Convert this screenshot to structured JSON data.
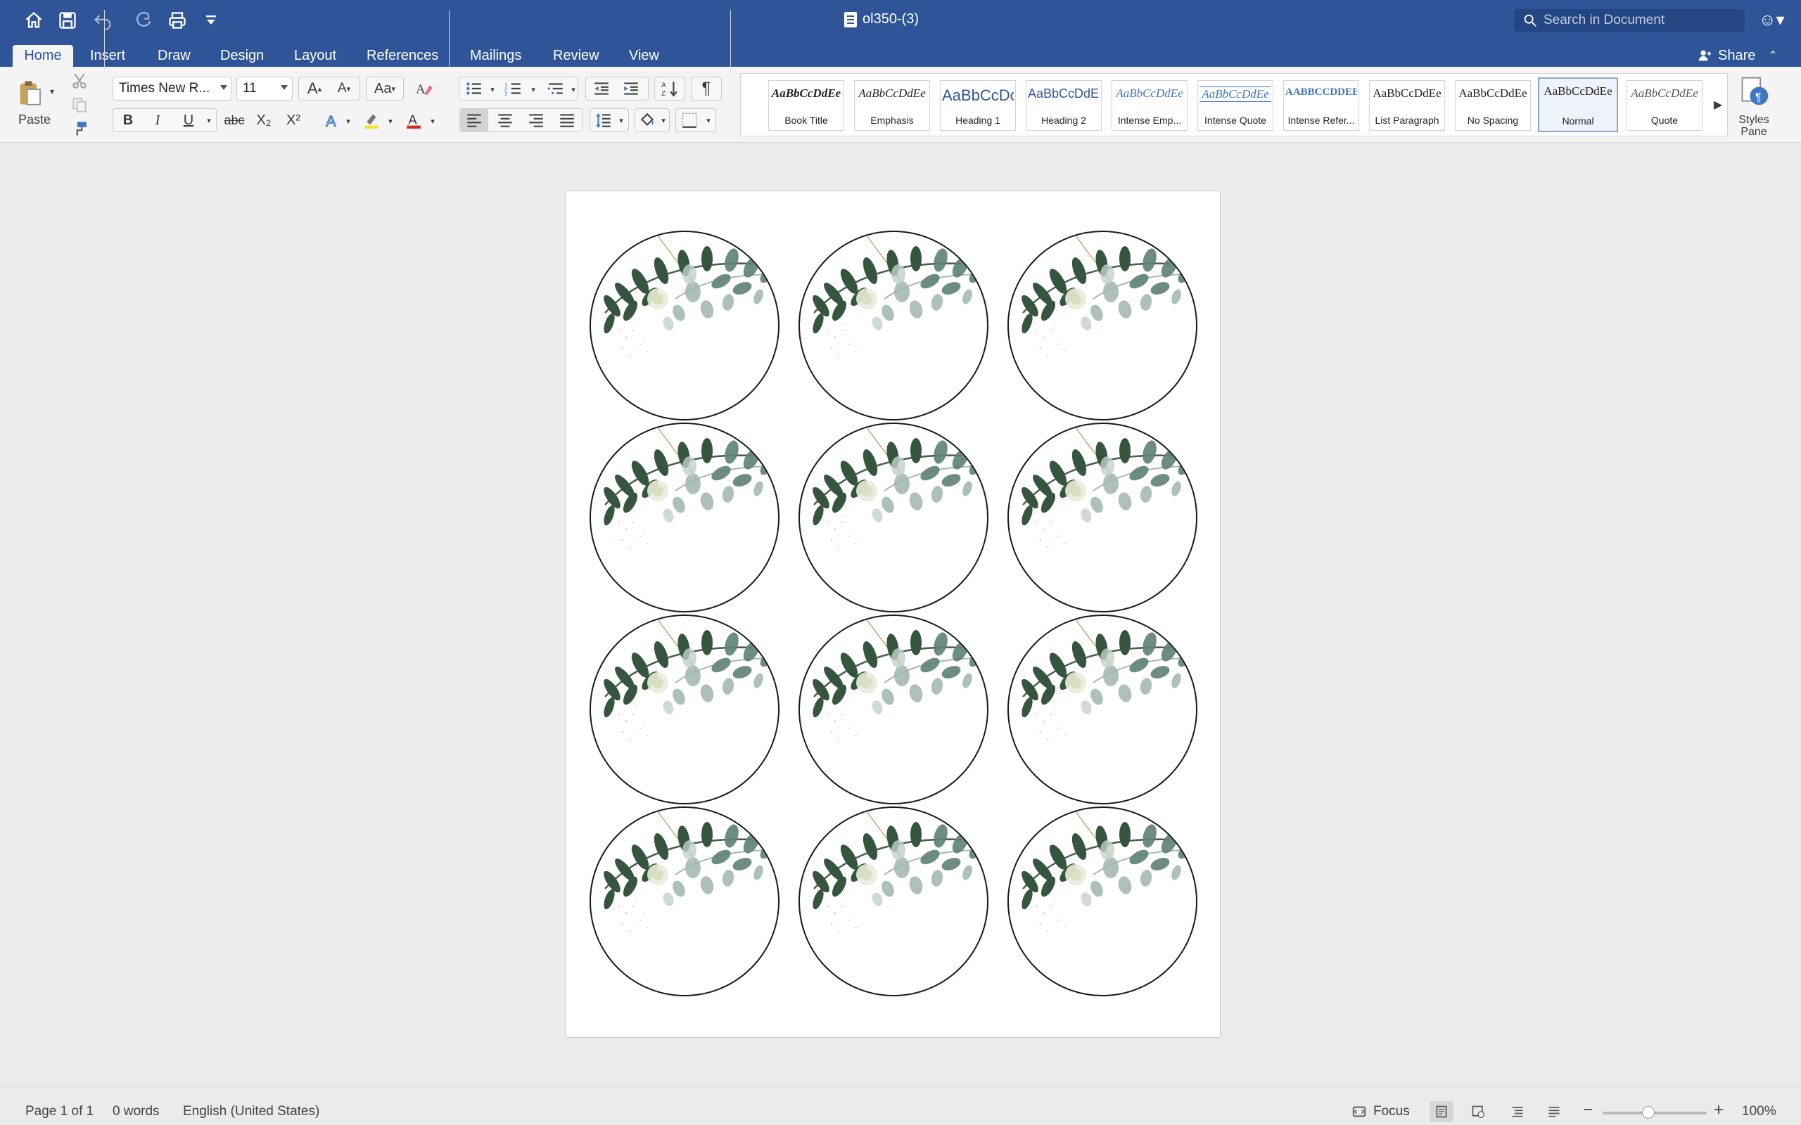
{
  "window": {
    "title": "ol350-(3)"
  },
  "search": {
    "placeholder": "Search in Document"
  },
  "tabs": [
    {
      "label": "Home",
      "active": true
    },
    {
      "label": "Insert"
    },
    {
      "label": "Draw"
    },
    {
      "label": "Design"
    },
    {
      "label": "Layout"
    },
    {
      "label": "References"
    },
    {
      "label": "Mailings"
    },
    {
      "label": "Review"
    },
    {
      "label": "View"
    }
  ],
  "share": {
    "label": "Share"
  },
  "ribbon": {
    "paste_label": "Paste",
    "font_name": "Times New R...",
    "font_size": "11",
    "bold": "B",
    "italic": "I",
    "underline": "U",
    "strike": "abc",
    "subscript": "X₂",
    "superscript": "X²",
    "pilcrow": "¶",
    "styles_pane_label": "Styles Pane"
  },
  "styles": [
    {
      "sample": "AaBbCcDdEe",
      "name": "Book Title"
    },
    {
      "sample": "AaBbCcDdEe",
      "name": "Emphasis"
    },
    {
      "sample": "AaBbCcDc",
      "name": "Heading 1"
    },
    {
      "sample": "AaBbCcDdEe",
      "name": "Heading 2"
    },
    {
      "sample": "AaBbCcDdEe",
      "name": "Intense Emp..."
    },
    {
      "sample": "AaBbCcDdEe",
      "name": "Intense Quote"
    },
    {
      "sample": "AABBCCDDEE",
      "name": "Intense Refer..."
    },
    {
      "sample": "AaBbCcDdEe",
      "name": "List Paragraph"
    },
    {
      "sample": "AaBbCcDdEe",
      "name": "No Spacing"
    },
    {
      "sample": "AaBbCcDdEe",
      "name": "Normal",
      "selected": true
    },
    {
      "sample": "AaBbCcDdEe",
      "name": "Quote"
    }
  ],
  "document": {
    "label_template": "circle with eucalyptus foliage",
    "rows": 4,
    "cols": 3
  },
  "status": {
    "page": "Page 1 of 1",
    "words": "0 words",
    "language": "English (United States)",
    "focus": "Focus",
    "zoom": "100%",
    "zoom_value": 100
  },
  "colors": {
    "title_bar": "#2f5598",
    "highlight_yellow": "#f5e12c",
    "font_red": "#d12d1f"
  }
}
